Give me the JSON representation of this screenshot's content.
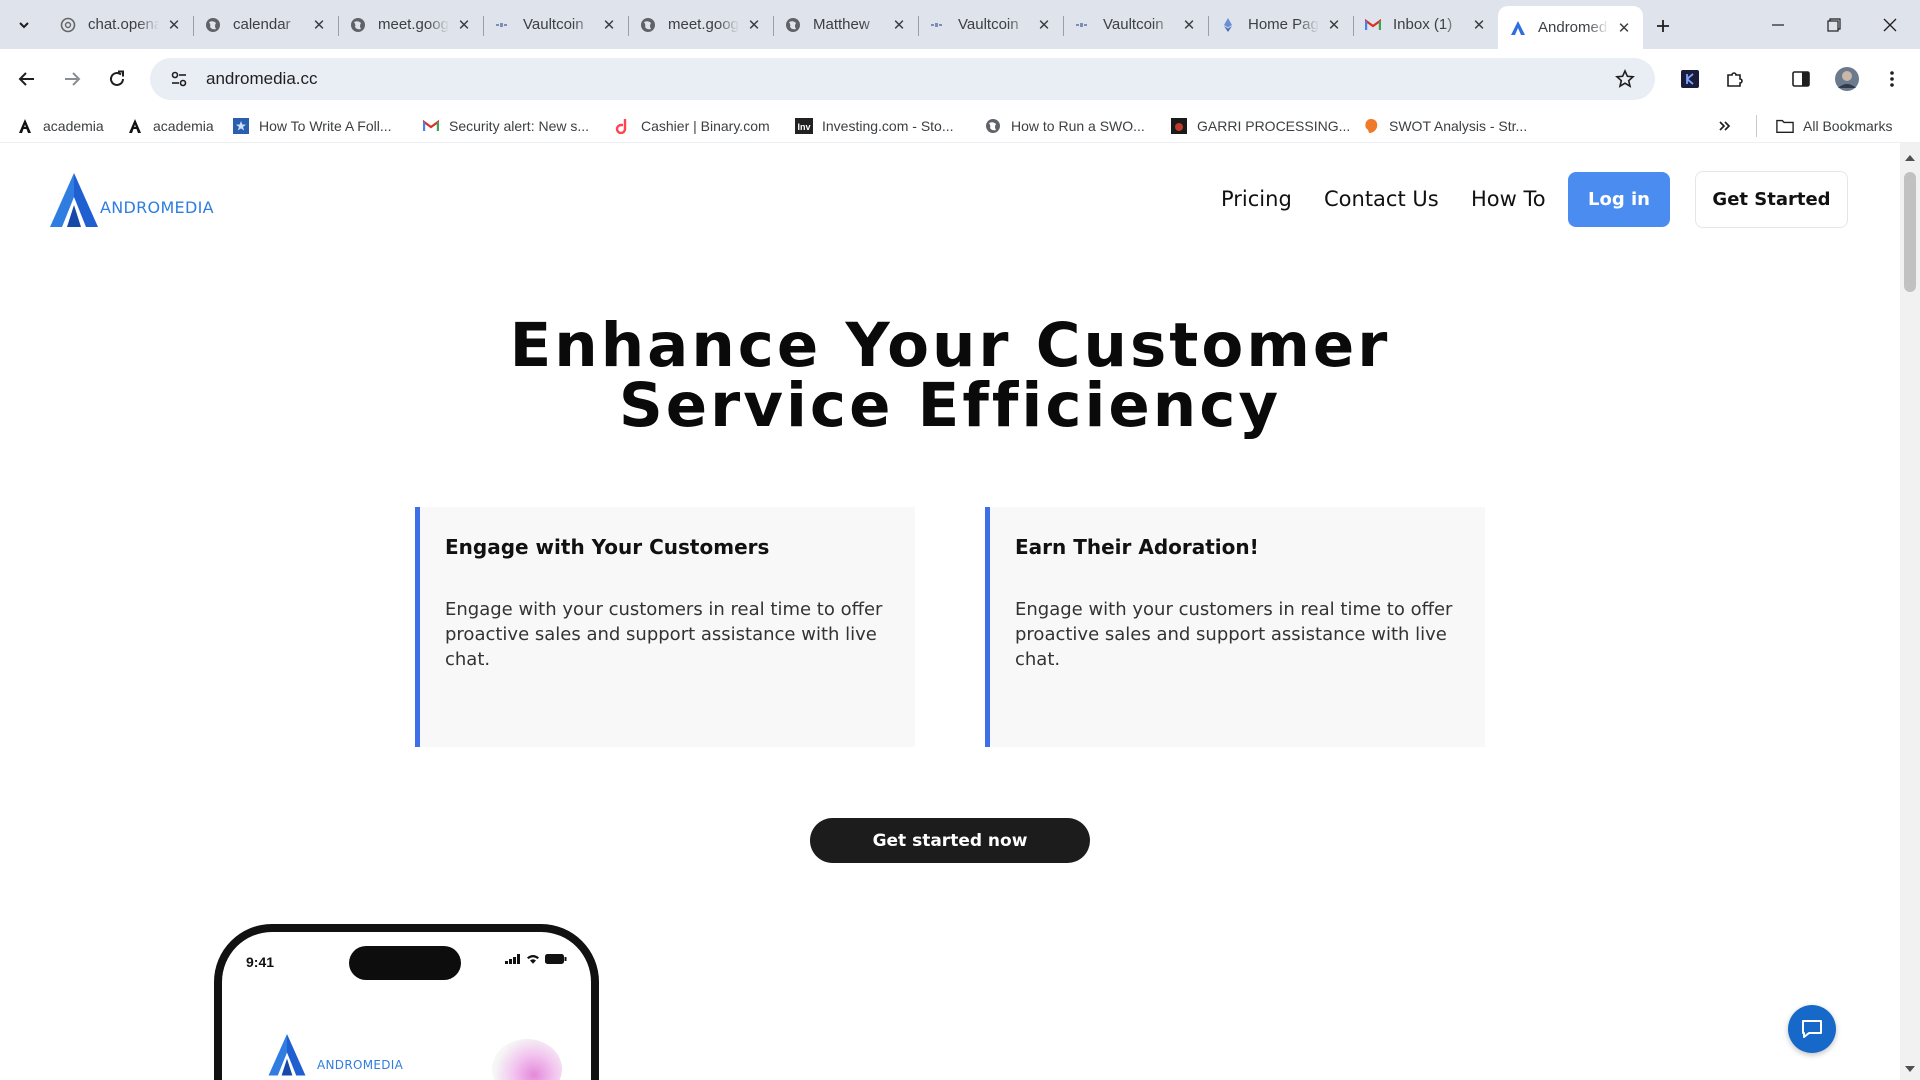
{
  "browser": {
    "tabs": [
      {
        "title": "chat.openai.com",
        "icon": "openai-icon"
      },
      {
        "title": "calendar",
        "icon": "globe-icon"
      },
      {
        "title": "meet.google.com",
        "icon": "globe-icon"
      },
      {
        "title": "Vaultcoin",
        "icon": "vaultcoin-icon"
      },
      {
        "title": "meet.google.com",
        "icon": "globe-icon"
      },
      {
        "title": "Matthew",
        "icon": "globe-icon"
      },
      {
        "title": "Vaultcoin",
        "icon": "vaultcoin-icon"
      },
      {
        "title": "Vaultcoin",
        "icon": "vaultcoin-icon"
      },
      {
        "title": "Home Page",
        "icon": "ethereum-icon"
      },
      {
        "title": "Inbox (1)",
        "icon": "gmail-icon"
      },
      {
        "title": "Andromedia",
        "icon": "andromedia-icon",
        "active": true
      }
    ],
    "url": "andromedia.cc",
    "bookmarks": [
      {
        "label": "academia",
        "icon": "academia-icon"
      },
      {
        "label": "academia",
        "icon": "academia-icon"
      },
      {
        "label": "How To Write A Foll...",
        "icon": "star-bookmark-icon"
      },
      {
        "label": "Security alert: New s...",
        "icon": "gmail-icon"
      },
      {
        "label": "Cashier | Binary.com",
        "icon": "binary-icon"
      },
      {
        "label": "Investing.com - Sto...",
        "icon": "investing-icon"
      },
      {
        "label": "How to Run a SWO...",
        "icon": "globe-icon"
      },
      {
        "label": "GARRI PROCESSING...",
        "icon": "garri-icon"
      },
      {
        "label": "SWOT Analysis - Str...",
        "icon": "swot-icon"
      }
    ],
    "all_bookmarks": "All Bookmarks"
  },
  "site": {
    "logo_text": "ANDROMEDIA",
    "nav": {
      "pricing": "Pricing",
      "contact": "Contact Us",
      "howto": "How To",
      "login": "Log in",
      "get_started": "Get Started"
    },
    "headline_line1": "Enhance Your Customer",
    "headline_line2": "Service Efficiency",
    "cards": [
      {
        "title": "Engage with Your Customers",
        "body": "Engage with your customers in real time to offer proactive sales and support assistance with live chat."
      },
      {
        "title": "Earn Their Adoration!",
        "body": "Engage with your customers in real time to offer proactive sales and support assistance with live chat."
      }
    ],
    "cta": "Get started now",
    "phone": {
      "time": "9:41",
      "logo_text": "ANDROMEDIA"
    }
  },
  "colors": {
    "accent": "#4b8cf0",
    "card_border": "#3e6ee8",
    "logo_blue": "#2f7de0",
    "chat_button": "#1769c9"
  }
}
